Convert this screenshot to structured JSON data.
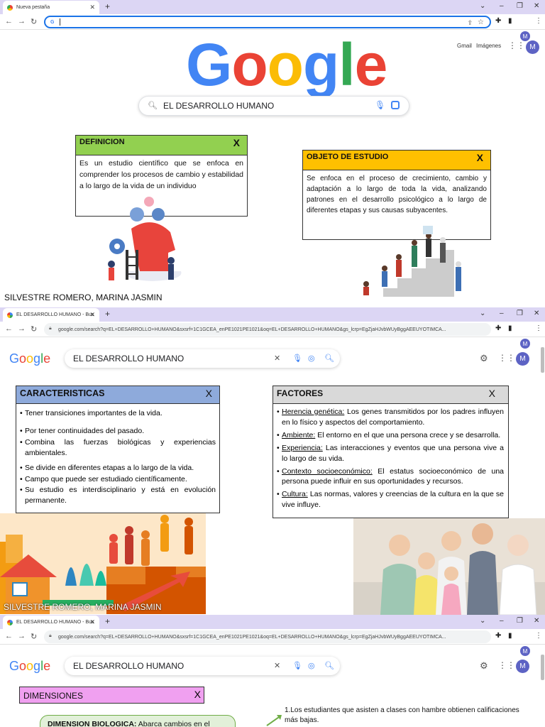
{
  "browser": {
    "tab1_title": "Nueva pestaña",
    "tab2_title": "EL DESARROLLO HUMANO - Bus",
    "tab3_title": "EL DESARROLLO HUMANO - Bus",
    "url": "google.com/search?q=EL+DESARROLLO+HUMANO&sxsrf=1C1GCEA_enPE1021PE1021&oq=EL+DESARROLLO+HUMANO&gs_lcrp=EgZjaHJvbWUyBggAEEUYOTIMCA...",
    "avatar_letter": "M"
  },
  "google": {
    "logo_letters": [
      "G",
      "o",
      "o",
      "g",
      "l",
      "e"
    ],
    "logo_colors": [
      "#4285F4",
      "#EA4335",
      "#FBBC05",
      "#4285F4",
      "#34A853",
      "#EA4335"
    ],
    "gmail": "Gmail",
    "images": "Imágenes",
    "query": "EL DESARROLLO HUMANO"
  },
  "panel1": {
    "definicion": {
      "title": "DEFINICION",
      "close": "X",
      "color": "#92d050",
      "text": "Es un estudio científico que se enfoca en comprender los procesos de cambio y estabilidad a lo largo de la vida de un individuo"
    },
    "objeto": {
      "title": "OBJETO DE ESTUDIO",
      "close": "X",
      "color": "#ffc000",
      "text": "Se enfoca en el proceso de crecimiento, cambio y adaptación a lo largo de toda la vida, analizando patrones en el desarrollo psicológico a lo largo de diferentes etapas y sus causas subyacentes."
    },
    "author": "SILVESTRE ROMERO, MARINA JASMIN"
  },
  "panel2": {
    "caracteristicas": {
      "title": "CARACTERISTICAS",
      "close": "X",
      "color": "#8eaadb",
      "items": [
        "Tener transiciones importantes de la vida.",
        "Por tener continuidades del pasado.",
        "Combina las fuerzas biológicas y experiencias ambientales.",
        "Se divide en diferentes etapas a lo largo de la vida.",
        "Campo que puede ser estudiado científicamente.",
        "Su estudio es interdisciplinario y está en evolución permanente."
      ]
    },
    "factores": {
      "title": "FACTORES",
      "close": "X",
      "color": "#d9d9d9",
      "items": [
        {
          "term": "Herencia genética:",
          "text": " Los genes transmitidos por los padres influyen en lo físico y aspectos del comportamiento."
        },
        {
          "term": "Ambiente:",
          "text": " El entorno en el que una persona crece y se desarrolla."
        },
        {
          "term": "Experiencia:",
          "text": " Las interacciones y eventos que una persona vive a lo largo de su vida."
        },
        {
          "term": "Contexto socioeconómico:",
          "text": " El estatus socioeconómico de una persona puede influir en sus oportunidades y recursos."
        },
        {
          "term": "Cultura:",
          "text": " Las normas, valores y creencias de la cultura en la que se vive influye."
        }
      ]
    },
    "author": "SILVESTRE ROMERO, MARINA JASMIN"
  },
  "panel3": {
    "dimensiones": {
      "title": "DIMENSIONES",
      "close": "X",
      "color": "#f0a0f0"
    },
    "biologica": {
      "term": "DIMENSION BIOLOGICA:",
      "text": " Abarca cambios en el"
    },
    "note": "1.Los estudiantes que asisten a clases con hambre obtienen calificaciones más bajas."
  }
}
